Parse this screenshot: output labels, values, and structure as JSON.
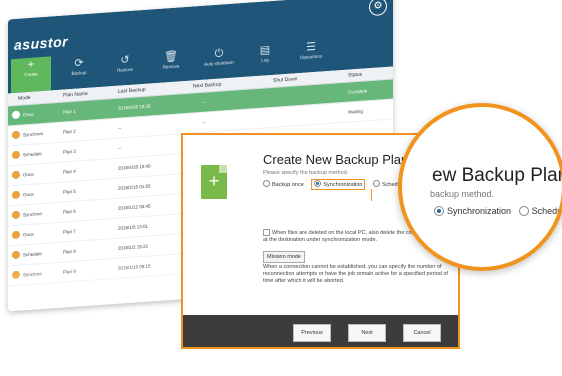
{
  "app": {
    "logo": "asustor",
    "toolbar": [
      {
        "label": "Create",
        "icon": "plus-icon",
        "glyph": "+"
      },
      {
        "label": "Backup",
        "icon": "backup-icon",
        "glyph": "⟳"
      },
      {
        "label": "Restore",
        "icon": "restore-icon",
        "glyph": "↺"
      },
      {
        "label": "Remove",
        "icon": "trash-icon",
        "glyph": "🗑"
      },
      {
        "label": "Auto shutdown",
        "icon": "power-icon",
        "glyph": "⏻"
      },
      {
        "label": "Log",
        "icon": "log-icon",
        "glyph": "▤"
      },
      {
        "label": "Operations",
        "icon": "operations-icon",
        "glyph": "☰"
      }
    ],
    "columns": [
      "Mode",
      "Plan Name",
      "Last Backup",
      "Next Backup",
      "Shut Down",
      "Status"
    ],
    "rows": [
      {
        "mode": "Once",
        "plan": "Plan 1",
        "last": "2016/4/28 10:35",
        "next": "--",
        "shut": "",
        "status": "Complete",
        "selected": true
      },
      {
        "mode": "Synchroni",
        "plan": "Plan 2",
        "last": "--",
        "next": "--",
        "shut": "",
        "status": "Waiting",
        "selected": false
      },
      {
        "mode": "Schedule",
        "plan": "Plan 3",
        "last": "--",
        "next": "",
        "shut": "",
        "status": "",
        "selected": false
      },
      {
        "mode": "Once",
        "plan": "Plan 4",
        "last": "2016/4/28 10:40",
        "next": "",
        "shut": "",
        "status": "",
        "selected": false
      },
      {
        "mode": "Once",
        "plan": "Plan 5",
        "last": "2016/2/16 01:55",
        "next": "",
        "shut": "",
        "status": "",
        "selected": false
      },
      {
        "mode": "Synchron",
        "plan": "Plan 6",
        "last": "2016/1/12 05:45",
        "next": "",
        "shut": "",
        "status": "",
        "selected": false
      },
      {
        "mode": "Once",
        "plan": "Plan 7",
        "last": "2016/1/5 13:01",
        "next": "",
        "shut": "",
        "status": "",
        "selected": false
      },
      {
        "mode": "Schedule",
        "plan": "Plan 8",
        "last": "2016/1/2 15:22",
        "next": "",
        "shut": "",
        "status": "",
        "selected": false
      },
      {
        "mode": "Synchron",
        "plan": "Plan 9",
        "last": "2016/1/15 08:15",
        "next": "",
        "shut": "",
        "status": "",
        "selected": false
      }
    ]
  },
  "dialog": {
    "title": "Create New Backup Plan",
    "subtitle": "Please specify the backup method.",
    "options": [
      "Backup once",
      "Synchronization",
      "Schedule Backup"
    ],
    "selected_option": "Synchronization",
    "delete_option": "When files are deleted on the local PC, also delete the corresponding files at the destination under synchronization mode.",
    "mission_button": "Mission mode",
    "mission_desc": "When a connection cannot be established, you can specify the number of reconnection attempts or have the job remain active for a specified period of time after which it will be aborted.",
    "buttons": {
      "previous": "Previous",
      "next": "Next",
      "cancel": "Cancel"
    }
  },
  "zoom": {
    "title": "ew Backup Plan",
    "subtitle": "backup method.",
    "option1": "Synchronization",
    "option2": "Schedule B"
  },
  "colors": {
    "header": "#1f5578",
    "accent": "#f0941d",
    "selected_row": "#67b67a",
    "create_button": "#5fb85c"
  }
}
